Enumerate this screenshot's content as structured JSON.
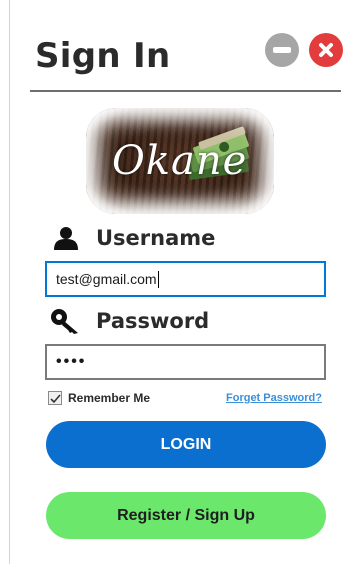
{
  "window": {
    "title": "Sign In",
    "minimize_icon": "minus-circle-icon",
    "close_icon": "close-circle-icon",
    "colors": {
      "minimize": "#a6a6a6",
      "close": "#e23c3c"
    }
  },
  "logo": {
    "brand_text": "Okane"
  },
  "form": {
    "username_label": "Username",
    "username_icon": "user-icon",
    "username_value": "test@gmail.com",
    "password_label": "Password",
    "password_icon": "key-icon",
    "password_mask": "••••",
    "remember_label": "Remember Me",
    "remember_checked": true,
    "forgot_link": "Forget Password?"
  },
  "actions": {
    "login_label": "LOGIN",
    "register_label": "Register / Sign Up",
    "colors": {
      "login": "#0b6fd0",
      "register": "#6be86b",
      "link": "#3b8fd9"
    }
  }
}
